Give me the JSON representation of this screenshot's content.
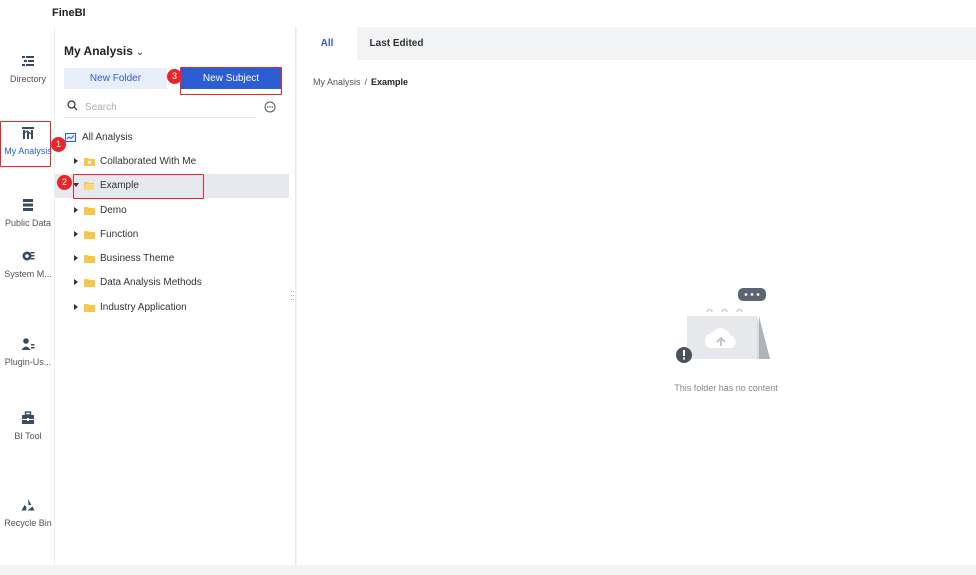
{
  "app": {
    "title": "FineBI"
  },
  "nav": {
    "items": [
      {
        "label": "Directory",
        "icon": "directory-icon"
      },
      {
        "label": "My Analysis",
        "icon": "my-analysis-icon"
      },
      {
        "label": "Public Data",
        "icon": "public-data-icon"
      },
      {
        "label": "System M...",
        "icon": "system-management-icon"
      },
      {
        "label": "Plugin-Us...",
        "icon": "plugin-user-icon"
      },
      {
        "label": "BI Tool",
        "icon": "bi-tool-icon"
      },
      {
        "label": "Recycle Bin",
        "icon": "recycle-bin-icon"
      }
    ],
    "active": "My Analysis"
  },
  "panel": {
    "title": "My Analysis",
    "new_folder": "New Folder",
    "new_subject": "New Subject",
    "search_placeholder": "Search",
    "tree": [
      {
        "label": "All Analysis",
        "level": 0
      },
      {
        "label": "Collaborated With Me",
        "level": 1
      },
      {
        "label": "Example",
        "level": 1,
        "selected": true
      },
      {
        "label": "Demo",
        "level": 1
      },
      {
        "label": "Function",
        "level": 1
      },
      {
        "label": "Business Theme",
        "level": 1
      },
      {
        "label": "Data Analysis Methods",
        "level": 1
      },
      {
        "label": "Industry Application",
        "level": 1
      }
    ]
  },
  "main": {
    "tabs": [
      "All",
      "Last Edited"
    ],
    "active_tab": "All",
    "breadcrumb": {
      "root": "My Analysis",
      "separator": "/",
      "current": "Example"
    },
    "empty_text": "This folder has no content"
  },
  "annotations": [
    "1",
    "2",
    "3"
  ],
  "colors": {
    "accent": "#2c5dd4",
    "highlight": "#e8262a",
    "folder": "#f7c64b"
  }
}
